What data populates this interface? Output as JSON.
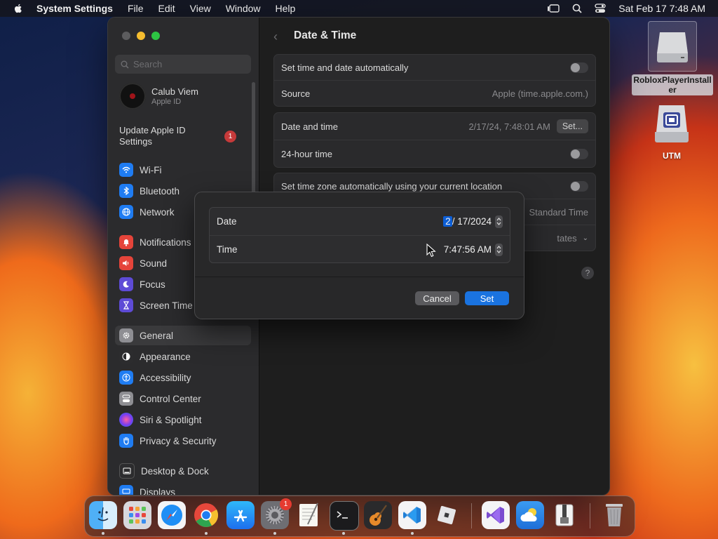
{
  "menubar": {
    "app_name": "System Settings",
    "items": [
      "File",
      "Edit",
      "View",
      "Window",
      "Help"
    ],
    "datetime": "Sat Feb 17  7:48 AM"
  },
  "sidebar": {
    "search_placeholder": "Search",
    "account_name": "Calub Viem",
    "account_sub": "Apple ID",
    "update_label": "Update Apple ID Settings",
    "update_badge": "1",
    "items": [
      {
        "label": "Wi-Fi",
        "icon": "wifi-icon",
        "color": "#1f7cf2"
      },
      {
        "label": "Bluetooth",
        "icon": "bluetooth-icon",
        "color": "#1f7cf2"
      },
      {
        "label": "Network",
        "icon": "globe-icon",
        "color": "#1f7cf2"
      },
      {
        "label": "Notifications",
        "icon": "bell-icon",
        "color": "#e5443a"
      },
      {
        "label": "Sound",
        "icon": "speaker-icon",
        "color": "#e5443a"
      },
      {
        "label": "Focus",
        "icon": "moon-icon",
        "color": "#5e4bd6"
      },
      {
        "label": "Screen Time",
        "icon": "hourglass-icon",
        "color": "#5e4bd6"
      },
      {
        "label": "General",
        "icon": "gear-icon",
        "color": "#8e8e93"
      },
      {
        "label": "Appearance",
        "icon": "appearance-icon",
        "color": "#2c2c2e"
      },
      {
        "label": "Accessibility",
        "icon": "accessibility-icon",
        "color": "#1f7cf2"
      },
      {
        "label": "Control Center",
        "icon": "control-center-icon",
        "color": "#8e8e93"
      },
      {
        "label": "Siri & Spotlight",
        "icon": "siri-icon",
        "color": "#c13ec9"
      },
      {
        "label": "Privacy & Security",
        "icon": "hand-icon",
        "color": "#1f7cf2"
      },
      {
        "label": "Desktop & Dock",
        "icon": "dock-icon",
        "color": "#2c2c2e"
      },
      {
        "label": "Displays",
        "icon": "display-icon",
        "color": "#1f7cf2"
      }
    ]
  },
  "content": {
    "title": "Date & Time",
    "auto_time_label": "Set time and date automatically",
    "source_label": "Source",
    "source_value": "Apple (time.apple.com.)",
    "date_time_label": "Date and time",
    "date_time_value": "2/17/24, 7:48:01 AM",
    "set_button": "Set...",
    "hour24_label": "24-hour time",
    "timezone_auto_label": "Set time zone automatically using your current location",
    "timezone_value": "Standard Time",
    "closest_city_value": "tates",
    "help": "?"
  },
  "dialog": {
    "date_label": "Date",
    "date_month": "2",
    "date_rest": "/ 17/2024",
    "time_label": "Time",
    "time_value": "7:47:56 AM",
    "cancel": "Cancel",
    "set": "Set"
  },
  "desktop": {
    "icons": [
      {
        "label": "RobloxPlayerInstaller"
      },
      {
        "label": "UTM"
      }
    ]
  },
  "dock": {
    "apps": [
      "Finder",
      "Launchpad",
      "Safari",
      "Chrome",
      "App Store",
      "System Settings",
      "TextEdit",
      "Terminal",
      "GarageBand",
      "VS Code",
      "Roblox",
      "Visual Studio",
      "Weather",
      "Archive Utility",
      "Trash"
    ],
    "settings_badge": "1"
  }
}
